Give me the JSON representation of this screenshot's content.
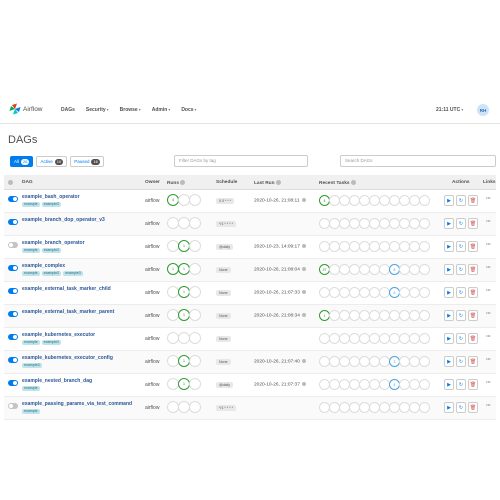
{
  "app": {
    "brand": "Airflow",
    "clock": "21:11 UTC",
    "user_initials": "RH"
  },
  "nav": {
    "items": [
      {
        "label": "DAGs",
        "dropdown": false
      },
      {
        "label": "Security",
        "dropdown": true
      },
      {
        "label": "Browse",
        "dropdown": true
      },
      {
        "label": "Admin",
        "dropdown": true
      },
      {
        "label": "Docs",
        "dropdown": true
      }
    ]
  },
  "page": {
    "title": "DAGs"
  },
  "filters": {
    "tabs": [
      {
        "label": "All",
        "count": "26"
      },
      {
        "label": "Active",
        "count": "10"
      },
      {
        "label": "Paused",
        "count": "16"
      }
    ],
    "tag_placeholder": "Filter DAGs by tag",
    "search_placeholder": "Search DAGs"
  },
  "table": {
    "headers": {
      "dag": "DAG",
      "owner": "Owner",
      "runs": "Runs",
      "schedule": "Schedule",
      "last_run": "Last Run",
      "recent_tasks": "Recent Tasks",
      "actions": "Actions",
      "links": "Links"
    },
    "rows": [
      {
        "name": "example_bash_operator",
        "tags": [
          "example",
          "example2"
        ],
        "owner": "airflow",
        "schedule": "0 0 * * *",
        "last_run": "2020-10-26, 21:08:11",
        "enabled": true,
        "runs": [
          "4",
          "",
          ""
        ],
        "tasks": {
          "0": "4"
        }
      },
      {
        "name": "example_branch_dop_operator_v3",
        "tags": [],
        "owner": "airflow",
        "schedule": "*/1 * * * *",
        "last_run": "",
        "enabled": true,
        "runs": [
          "",
          "",
          ""
        ],
        "tasks": {}
      },
      {
        "name": "example_branch_operator",
        "tags": [
          "example",
          "example2"
        ],
        "owner": "airflow",
        "schedule": "@daily",
        "last_run": "2020-10-23, 14:09:17",
        "enabled": false,
        "runs": [
          "",
          "1",
          ""
        ],
        "tasks": {}
      },
      {
        "name": "example_complex",
        "tags": [
          "example",
          "example2",
          "example3"
        ],
        "owner": "airflow",
        "schedule": "None",
        "last_run": "2020-10-26, 21:08:04",
        "enabled": true,
        "runs": [
          "1",
          "1",
          ""
        ],
        "tasks": {
          "0": "37",
          "7": "8"
        }
      },
      {
        "name": "example_external_task_marker_child",
        "tags": [],
        "owner": "airflow",
        "schedule": "None",
        "last_run": "2020-10-26, 21:07:33",
        "enabled": true,
        "runs": [
          "",
          "1",
          ""
        ],
        "tasks": {
          "7": "6"
        }
      },
      {
        "name": "example_external_task_marker_parent",
        "tags": [],
        "owner": "airflow",
        "schedule": "None",
        "last_run": "2020-10-26, 21:08:34",
        "enabled": true,
        "runs": [
          "",
          "1",
          ""
        ],
        "tasks": {
          "0": "1"
        }
      },
      {
        "name": "example_kubernetes_executor",
        "tags": [
          "example",
          "example2"
        ],
        "owner": "airflow",
        "schedule": "None",
        "last_run": "",
        "enabled": true,
        "runs": [
          "",
          "",
          ""
        ],
        "tasks": {}
      },
      {
        "name": "example_kubernetes_executor_config",
        "tags": [
          "example3"
        ],
        "owner": "airflow",
        "schedule": "None",
        "last_run": "2020-10-26, 21:07:40",
        "enabled": true,
        "runs": [
          "",
          "1",
          ""
        ],
        "tasks": {
          "7": "3"
        }
      },
      {
        "name": "example_nested_branch_dag",
        "tags": [
          "example"
        ],
        "owner": "airflow",
        "schedule": "@daily",
        "last_run": "2020-10-26, 21:07:37",
        "enabled": true,
        "runs": [
          "",
          "1",
          ""
        ],
        "tasks": {
          "7": "4"
        }
      },
      {
        "name": "example_passing_params_via_test_command",
        "tags": [
          "example"
        ],
        "owner": "airflow",
        "schedule": "*/1 * * * *",
        "last_run": "",
        "enabled": false,
        "runs": [
          "",
          "",
          ""
        ],
        "tasks": {}
      }
    ]
  },
  "colors": {
    "accent": "#017cee",
    "success": "#2e9b2e",
    "running": "#4aa3df",
    "danger": "#d9534f"
  },
  "icons": {
    "logo": "airflow-pinwheel-icon",
    "trigger": "play-icon",
    "refresh": "refresh-icon",
    "delete": "trash-icon",
    "links": "ellipsis-icon"
  }
}
